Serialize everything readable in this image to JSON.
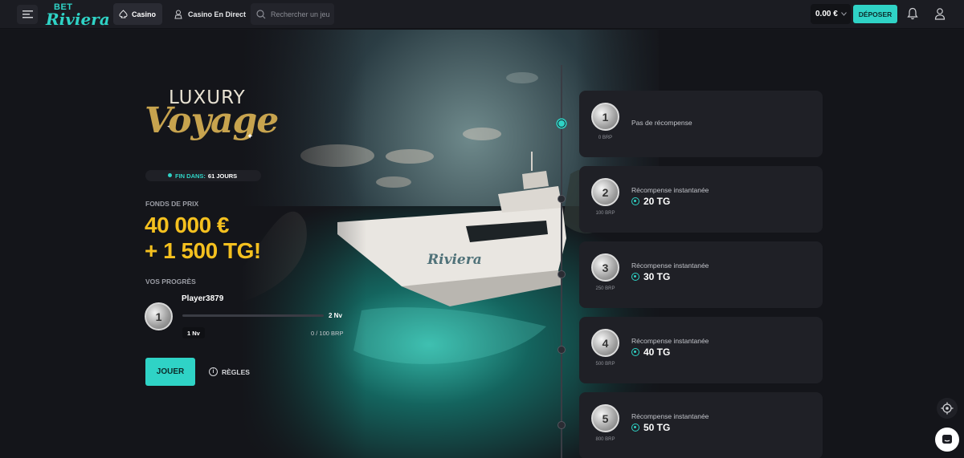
{
  "header": {
    "logo_top": "BET",
    "logo_bottom": "Riviera",
    "nav_casino": "Casino",
    "nav_live": "Casino En Direct",
    "search_placeholder": "Rechercher un jeu",
    "balance": "0.00 €",
    "deposit": "DÉPOSER"
  },
  "promo": {
    "brand_top": "LUXURY",
    "brand_bottom": "Voyage",
    "ends_label": "FIN DANS:",
    "ends_value": "61 JOURS",
    "prize_label": "FONDS DE PRIX",
    "prize_line1": "40 000 €",
    "prize_line2": "+ 1 500 TG!",
    "progress_label": "VOS PROGRÈS",
    "current_level_num": "1",
    "player_name": "Player3879",
    "next_level": "2 Nv",
    "current_level": "1 Nv",
    "brp_progress": "0 / 100 BRP",
    "progress_fraction": 0,
    "play_button": "JOUER",
    "rules_link": "RÈGLES"
  },
  "levels": [
    {
      "num": "1",
      "brp": "0 BRP",
      "title": "Pas de récompense",
      "reward": ""
    },
    {
      "num": "2",
      "brp": "100 BRP",
      "title": "Récompense instantanée",
      "reward": "20 TG"
    },
    {
      "num": "3",
      "brp": "250 BRP",
      "title": "Récompense instantanée",
      "reward": "30 TG"
    },
    {
      "num": "4",
      "brp": "500 BRP",
      "title": "Récompense instantanée",
      "reward": "40 TG"
    },
    {
      "num": "5",
      "brp": "800 BRP",
      "title": "Récompense instantanée",
      "reward": "50 TG"
    }
  ],
  "colors": {
    "accent": "#2fd3c6",
    "prize": "#f4c01f",
    "card": "#1f2026",
    "background": "#14151a"
  }
}
